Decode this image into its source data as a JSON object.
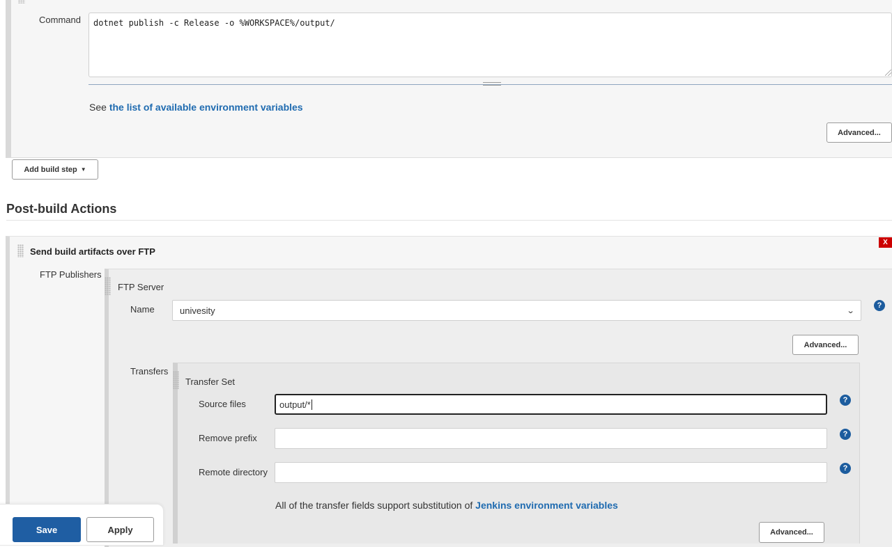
{
  "build_step": {
    "command_label": "Command",
    "command_value": "dotnet publish -c Release -o %WORKSPACE%/output/",
    "env_help_prefix": "See ",
    "env_help_link": "the list of available environment variables",
    "advanced_label": "Advanced..."
  },
  "add_build_step": {
    "label": "Add build step",
    "caret": "▼"
  },
  "post_build": {
    "title": "Post-build Actions",
    "publisher": {
      "title": "Send build artifacts over FTP",
      "delete_label": "X",
      "ftp_publishers_label": "FTP Publishers",
      "server": {
        "title": "FTP Server",
        "name_label": "Name",
        "name_value": "univesity",
        "advanced_label": "Advanced...",
        "transfers_label": "Transfers",
        "transfer_set": {
          "title": "Transfer Set",
          "source_files_label": "Source files",
          "source_files_value": "output/*",
          "remove_prefix_label": "Remove prefix",
          "remove_prefix_value": "",
          "remote_directory_label": "Remote directory",
          "remote_directory_value": "",
          "note_prefix": "All of the transfer fields support substitution of ",
          "note_link": "Jenkins environment variables",
          "advanced_label": "Advanced..."
        }
      }
    }
  },
  "help_glyph": "?",
  "icons": {
    "help": "help-icon",
    "dropdown": "chevron-down-icon",
    "drag": "drag-handle-icon",
    "delete": "close-icon"
  },
  "footer": {
    "save_label": "Save",
    "apply_label": "Apply"
  },
  "colors": {
    "link": "#1f6bb0",
    "primary_button": "#1f5ea3",
    "delete": "#cc0000",
    "help": "#1c5c9e"
  }
}
